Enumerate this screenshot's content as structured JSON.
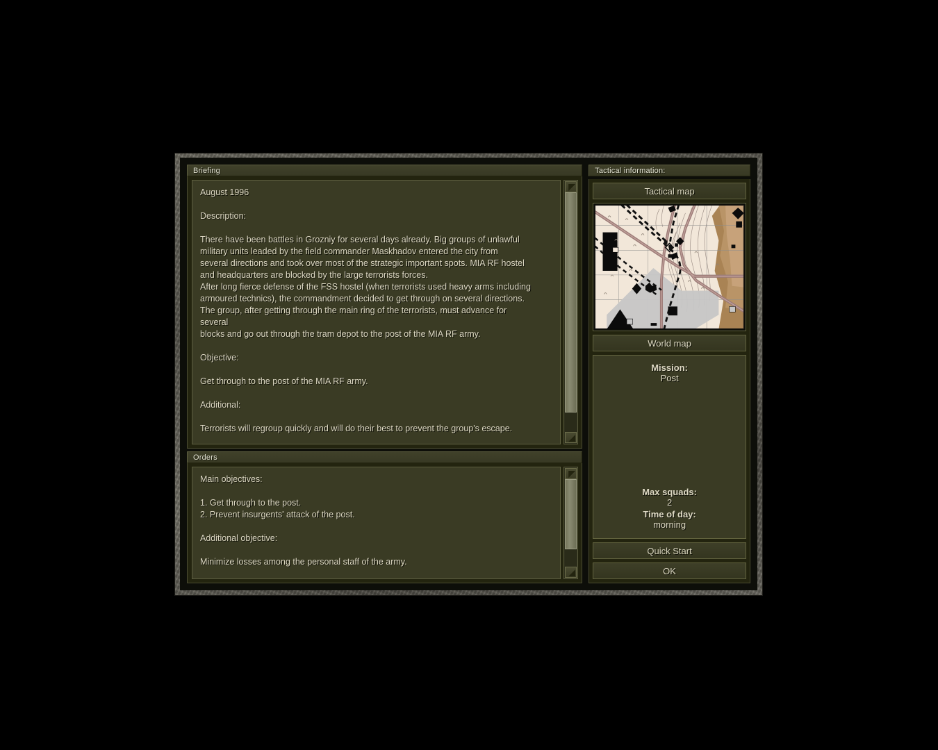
{
  "briefing": {
    "title": "Briefing",
    "body": "August 1996\n\nDescription:\n\nThere have been battles in Grozniy for several days already. Big groups of unlawful\nmilitary units leaded by the field commander Maskhadov entered the city from\nseveral directions and took over most of the strategic important spots. MIA RF hostel\nand headquarters are blocked by the large terrorists forces.\nAfter long fierce defense of the FSS hostel (when terrorists used heavy arms including\narmoured technics), the commandment decided to get through on several directions.\nThe group, after getting through the main ring of the terrorists, must advance for\nseveral\nblocks and go out through the tram depot to the post of the MIA RF army.\n\nObjective:\n\nGet through to the post of the MIA RF army.\n\nAdditional:\n\nTerrorists will regroup quickly and will do their best to prevent the group's escape."
  },
  "orders": {
    "title": "Orders",
    "body": "Main objectives:\n\n1. Get through to the post.\n2. Prevent insurgents' attack of the post.\n\nAdditional objective:\n\nMinimize losses among the personal staff of the army."
  },
  "tactical": {
    "title": "Tactical information:",
    "tactical_map_label": "Tactical map",
    "world_map_label": "World map",
    "mission_key": "Mission:",
    "mission_value": "Post",
    "max_squads_key": "Max squads:",
    "max_squads_value": "2",
    "time_of_day_key": "Time of day:",
    "time_of_day_value": "morning",
    "quick_start_label": "Quick Start",
    "ok_label": "OK"
  },
  "colors": {
    "panel_bg": "#3a3b24",
    "frame_dark": "#23240f",
    "border_olive": "#63643f",
    "text": "#ded9c4",
    "map_road": "#9c7b77",
    "map_urban": "#c4c4c4",
    "map_terrain_light": "#f0e4d6",
    "map_terrain_dark": "#a98354"
  }
}
